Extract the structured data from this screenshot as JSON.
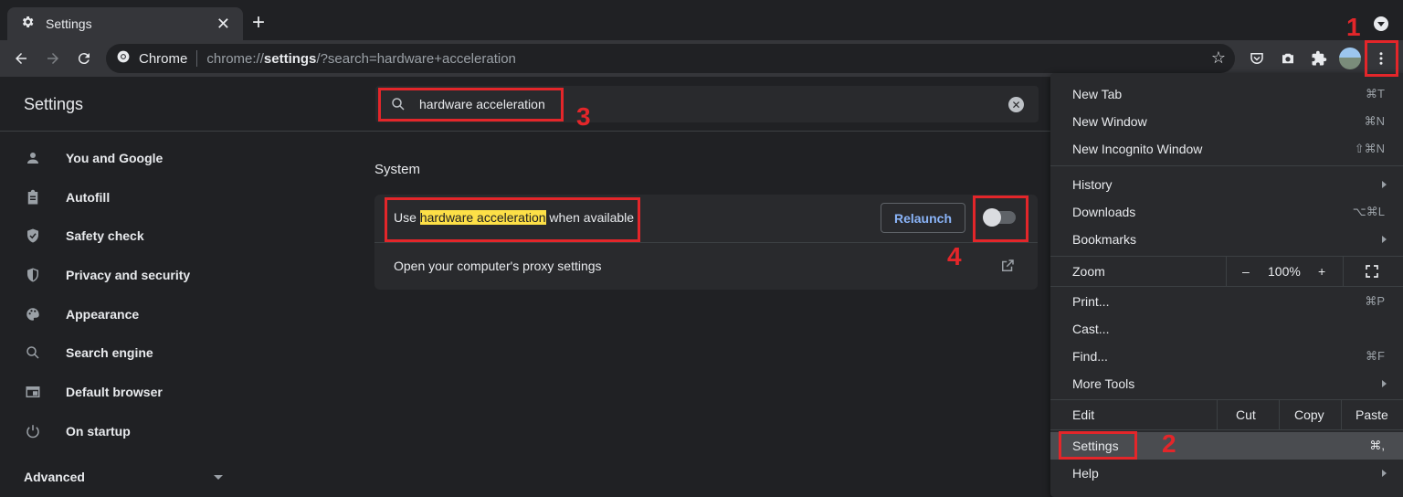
{
  "tab": {
    "title": "Settings",
    "close": "✕",
    "new_tab": "+"
  },
  "toolbar": {
    "omnibox_site": "Chrome",
    "url_scheme": "chrome://",
    "url_host": "settings",
    "url_rest": "/?search=hardware+acceleration"
  },
  "settings": {
    "title": "Settings",
    "search_value": "hardware acceleration"
  },
  "sidebar": {
    "items": [
      {
        "label": "You and Google",
        "icon": "person-icon"
      },
      {
        "label": "Autofill",
        "icon": "clipboard-icon"
      },
      {
        "label": "Safety check",
        "icon": "shield-check-icon"
      },
      {
        "label": "Privacy and security",
        "icon": "shield-icon"
      },
      {
        "label": "Appearance",
        "icon": "palette-icon"
      },
      {
        "label": "Search engine",
        "icon": "search-icon"
      },
      {
        "label": "Default browser",
        "icon": "browser-icon"
      },
      {
        "label": "On startup",
        "icon": "power-icon"
      }
    ],
    "advanced": "Advanced"
  },
  "main": {
    "section_title": "System",
    "row1": {
      "prefix": "Use ",
      "highlight": "hardware acceleration",
      "suffix": " when available",
      "button": "Relaunch",
      "toggle_on": false
    },
    "row2": {
      "label": "Open your computer's proxy settings"
    }
  },
  "menu": {
    "new_tab": "New Tab",
    "new_tab_sc": "⌘T",
    "new_window": "New Window",
    "new_window_sc": "⌘N",
    "incognito": "New Incognito Window",
    "incognito_sc": "⇧⌘N",
    "history": "History",
    "downloads": "Downloads",
    "downloads_sc": "⌥⌘L",
    "bookmarks": "Bookmarks",
    "zoom": "Zoom",
    "zoom_minus": "–",
    "zoom_value": "100%",
    "zoom_plus": "+",
    "print": "Print...",
    "print_sc": "⌘P",
    "cast": "Cast...",
    "find": "Find...",
    "find_sc": "⌘F",
    "more_tools": "More Tools",
    "edit": "Edit",
    "cut": "Cut",
    "copy": "Copy",
    "paste": "Paste",
    "settings": "Settings",
    "settings_sc": "⌘,",
    "help": "Help"
  },
  "annotations": {
    "n1": "1",
    "n2": "2",
    "n3": "3",
    "n4": "4",
    "color": "#e3262a"
  },
  "colors": {
    "highlight": "#fde047",
    "link_blue": "#8ab4f8"
  }
}
